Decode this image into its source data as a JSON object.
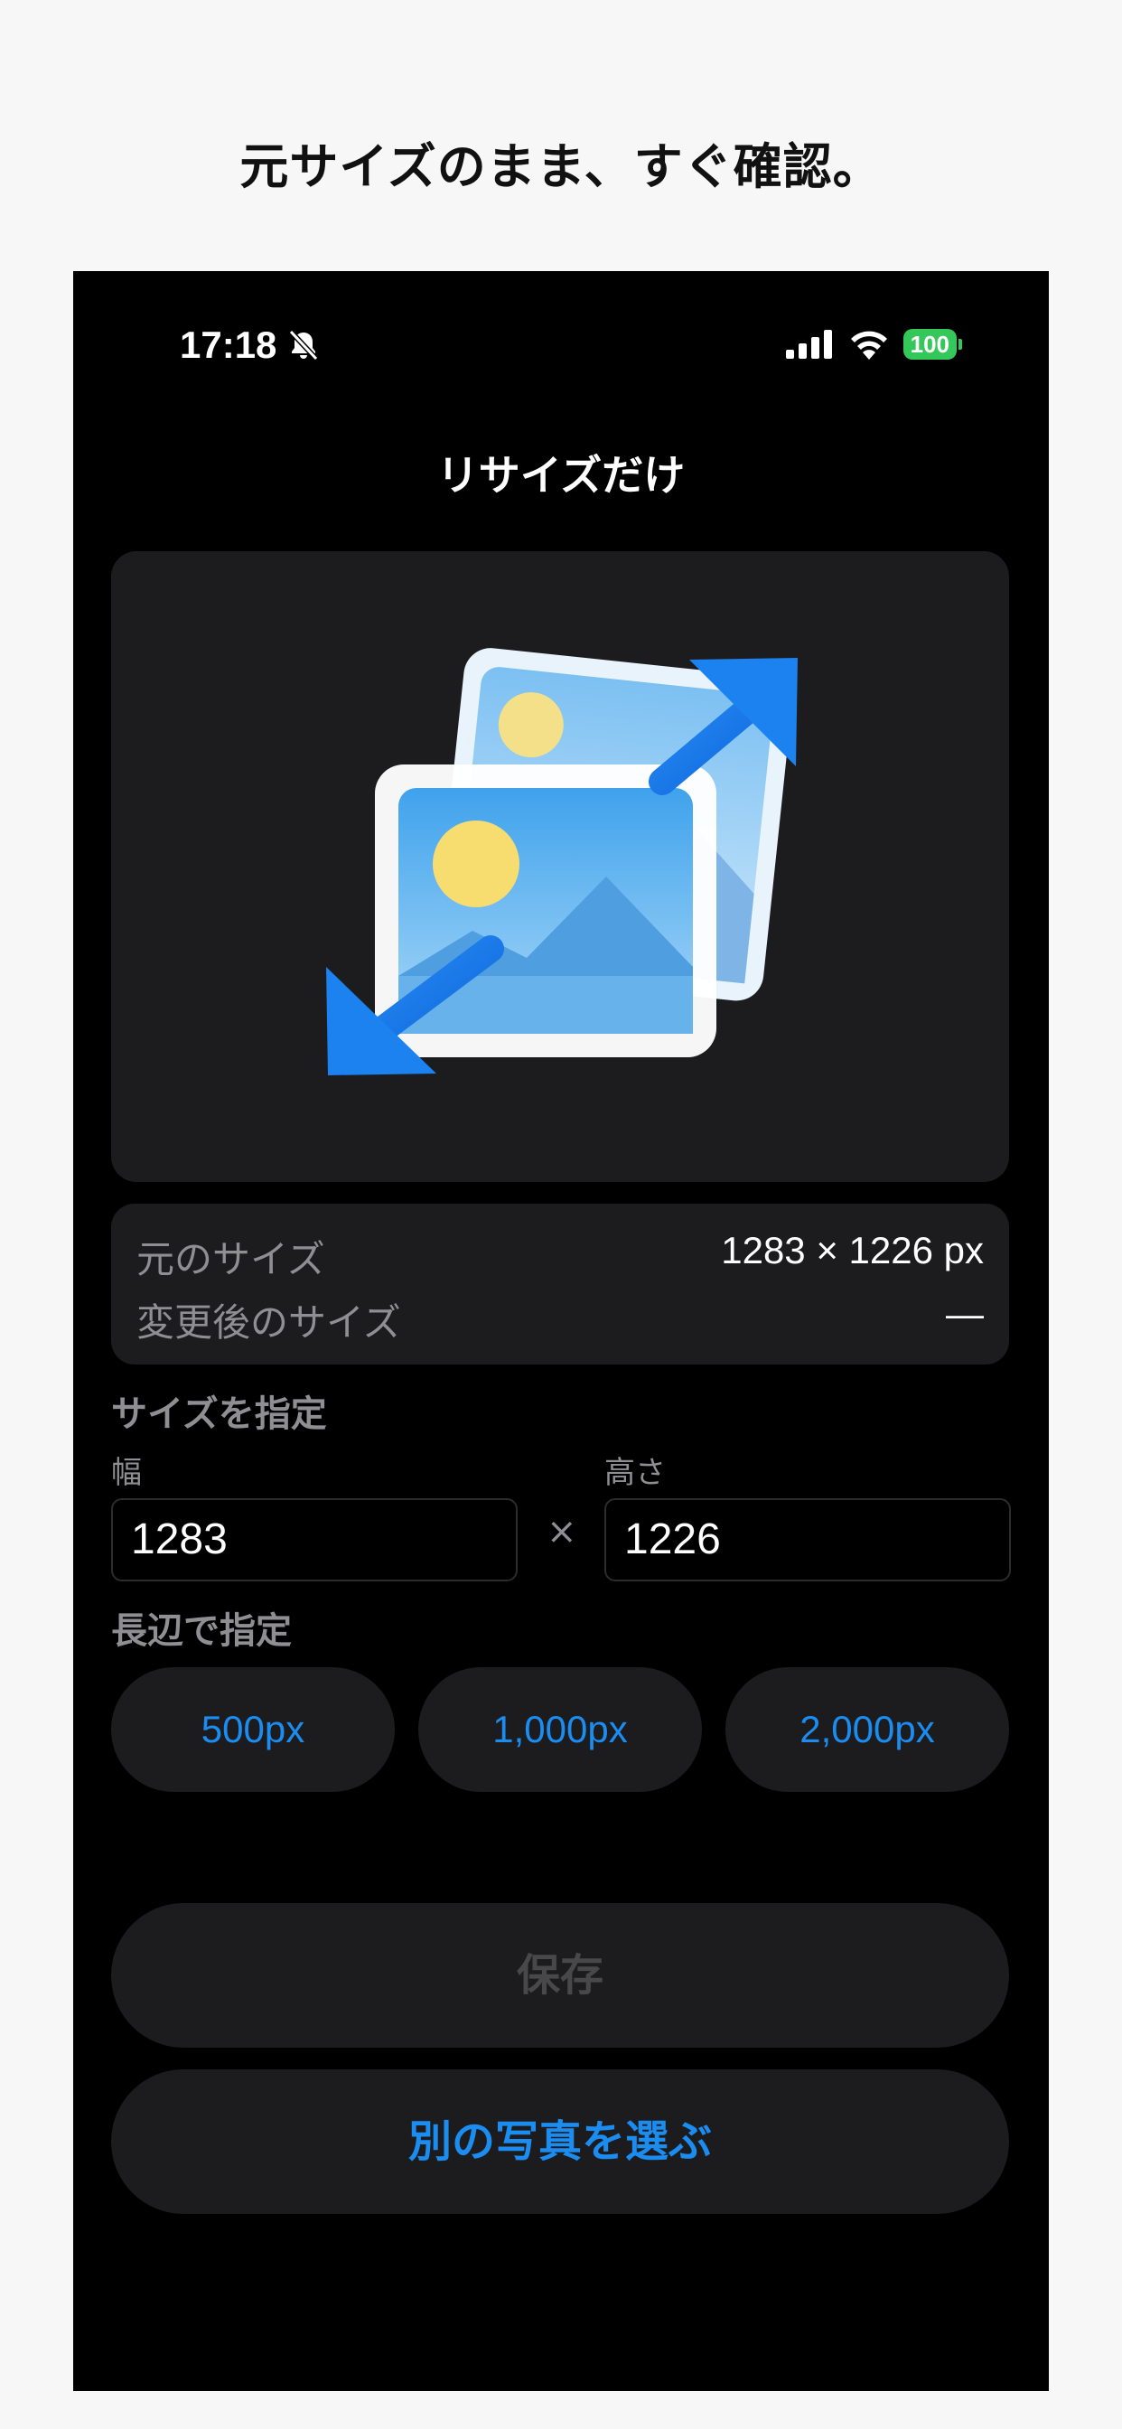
{
  "caption": "元サイズのまま、すぐ確認。",
  "status_bar": {
    "time": "17:18",
    "battery": "100",
    "icons": [
      "bell-slash-icon",
      "cellular-signal-icon",
      "wifi-icon",
      "battery-icon"
    ]
  },
  "nav": {
    "title": "リサイズだけ"
  },
  "info": {
    "original_label": "元のサイズ",
    "original_value": "1283 × 1226 px",
    "new_label": "変更後のサイズ",
    "new_value": "—"
  },
  "size_section": {
    "title": "サイズを指定",
    "width_label": "幅",
    "width_value": "1283",
    "times": "×",
    "height_label": "高さ",
    "height_value": "1226"
  },
  "long_side": {
    "title": "長辺で指定",
    "presets": [
      "500px",
      "1,000px",
      "2,000px"
    ]
  },
  "buttons": {
    "save": "保存",
    "choose": "別の写真を選ぶ"
  },
  "colors": {
    "accent": "#1b8cf0",
    "card": "#1c1c1e",
    "battery": "#34c759"
  }
}
